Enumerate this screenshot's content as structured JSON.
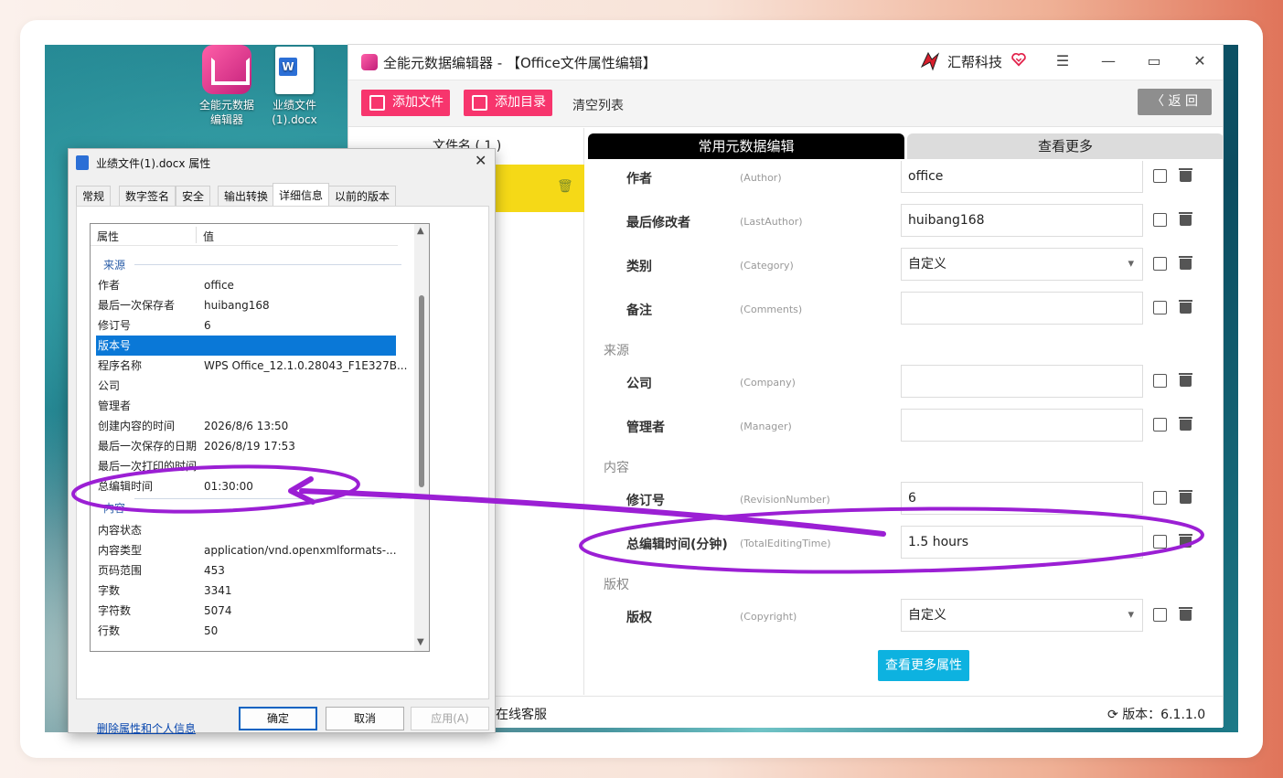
{
  "desktop": {
    "icons": [
      {
        "label_line1": "全能元数据",
        "label_line2": "编辑器"
      },
      {
        "label_line1": "业绩文件",
        "label_line2": "(1).docx"
      }
    ]
  },
  "app": {
    "title": "全能元数据编辑器 - 【Office文件属性编辑】",
    "brand": "汇帮科技",
    "toolbar": {
      "add_file": "添加文件",
      "add_dir": "添加目录",
      "clear_list": "清空列表",
      "back": "返 回"
    },
    "file_list": {
      "header": "文件名 ( 1 )"
    },
    "tabs": {
      "active": "常用元数据编辑",
      "inactive": "查看更多"
    },
    "sections": {
      "source": "来源",
      "content": "内容",
      "copyright": "版权"
    },
    "props": [
      {
        "name": "作者",
        "key": "(Author)",
        "value": "office",
        "type": "text"
      },
      {
        "name": "最后修改者",
        "key": "(LastAuthor)",
        "value": "huibang168",
        "type": "text"
      },
      {
        "name": "类别",
        "key": "(Category)",
        "value": "自定义",
        "type": "select"
      },
      {
        "name": "备注",
        "key": "(Comments)",
        "value": "",
        "type": "text"
      },
      {
        "name": "公司",
        "key": "(Company)",
        "value": "",
        "type": "text"
      },
      {
        "name": "管理者",
        "key": "(Manager)",
        "value": "",
        "type": "text"
      },
      {
        "name": "修订号",
        "key": "(RevisionNumber)",
        "value": "6",
        "type": "text"
      },
      {
        "name": "总编辑时间(分钟)",
        "key": "(TotalEditingTime)",
        "value": "1.5 hours",
        "type": "text"
      },
      {
        "name": "版权",
        "key": "(Copyright)",
        "value": "自定义",
        "type": "select"
      }
    ],
    "more_props_button": "查看更多属性",
    "status": {
      "online_service": "在线客服",
      "version": "版本：6.1.1.0"
    }
  },
  "dialog": {
    "title": "业绩文件(1).docx 属性",
    "tabs": [
      "常规",
      "数字签名",
      "安全",
      "输出转换",
      "详细信息",
      "以前的版本"
    ],
    "active_tab": "详细信息",
    "columns": {
      "prop": "属性",
      "value": "值"
    },
    "group_source": "来源",
    "group_content": "内容",
    "rows": [
      {
        "prop": "作者",
        "value": "office"
      },
      {
        "prop": "最后一次保存者",
        "value": "huibang168"
      },
      {
        "prop": "修订号",
        "value": "6"
      },
      {
        "prop": "版本号",
        "value": ""
      },
      {
        "prop": "程序名称",
        "value": "WPS Office_12.1.0.28043_F1E327B..."
      },
      {
        "prop": "公司",
        "value": ""
      },
      {
        "prop": "管理者",
        "value": ""
      },
      {
        "prop": "创建内容的时间",
        "value": "2026/8/6 13:50"
      },
      {
        "prop": "最后一次保存的日期",
        "value": "2026/8/19 17:53"
      },
      {
        "prop": "最后一次打印的时间",
        "value": ""
      },
      {
        "prop": "总编辑时间",
        "value": "01:30:00"
      }
    ],
    "content_rows": [
      {
        "prop": "内容状态",
        "value": ""
      },
      {
        "prop": "内容类型",
        "value": "application/vnd.openxmlformats-..."
      },
      {
        "prop": "页码范围",
        "value": "453"
      },
      {
        "prop": "字数",
        "value": "3341"
      },
      {
        "prop": "字符数",
        "value": "5074"
      },
      {
        "prop": "行数",
        "value": "50"
      }
    ],
    "remove_link": "删除属性和个人信息",
    "buttons": {
      "ok": "确定",
      "cancel": "取消",
      "apply": "应用(A)"
    }
  },
  "colors": {
    "accent_pink": "#f7356d",
    "selected_file": "#f5d917",
    "more_button": "#0db2e0",
    "annotation": "#9b1fd4",
    "selection_blue": "#0a78d7"
  }
}
